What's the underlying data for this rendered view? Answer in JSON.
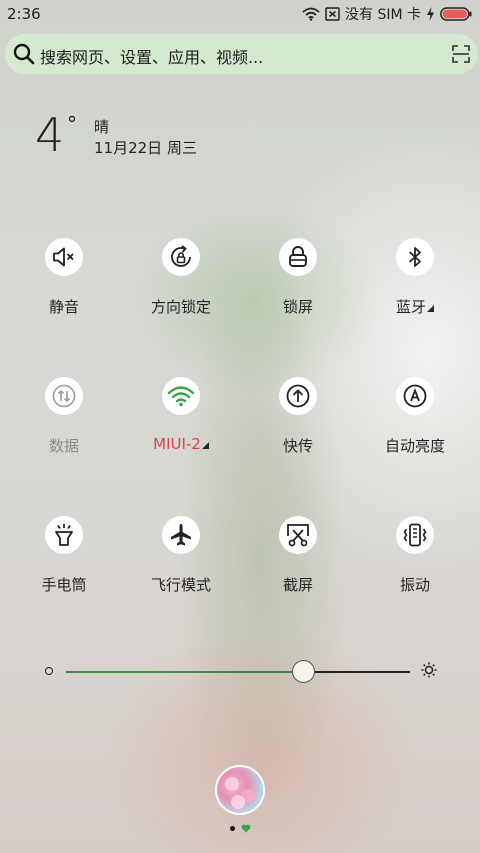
{
  "status_bar": {
    "time": "2:36",
    "carrier_text": "没有 SIM 卡",
    "battery_color": "#e85b5b"
  },
  "search": {
    "placeholder": "搜索网页、设置、应用、视频..."
  },
  "weather": {
    "temperature": "4",
    "degree": "°",
    "condition": "晴",
    "date": "11月22日 周三"
  },
  "toggles": [
    {
      "label": "静音",
      "icon": "mute-icon",
      "active": false
    },
    {
      "label": "方向锁定",
      "icon": "rotation-lock-icon",
      "active": false
    },
    {
      "label": "锁屏",
      "icon": "lock-screen-icon",
      "active": false
    },
    {
      "label": "蓝牙",
      "icon": "bluetooth-icon",
      "active": false,
      "has_submenu": true
    },
    {
      "label": "数据",
      "icon": "mobile-data-icon",
      "active": false,
      "disabled": true
    },
    {
      "label": "MIUI-2",
      "icon": "wifi-icon",
      "active": true,
      "has_submenu": true,
      "label_color": "#e0454a",
      "icon_color": "#3aa248"
    },
    {
      "label": "快传",
      "icon": "quick-transfer-icon",
      "active": false
    },
    {
      "label": "自动亮度",
      "icon": "auto-brightness-icon",
      "active": false
    },
    {
      "label": "手电筒",
      "icon": "flashlight-icon",
      "active": false
    },
    {
      "label": "飞行模式",
      "icon": "airplane-icon",
      "active": false
    },
    {
      "label": "截屏",
      "icon": "screenshot-icon",
      "active": false
    },
    {
      "label": "振动",
      "icon": "vibrate-icon",
      "active": false
    }
  ],
  "brightness": {
    "level": 0.69,
    "fill_color": "#3e8a40"
  },
  "pager": {
    "count": 2,
    "current": 2
  }
}
